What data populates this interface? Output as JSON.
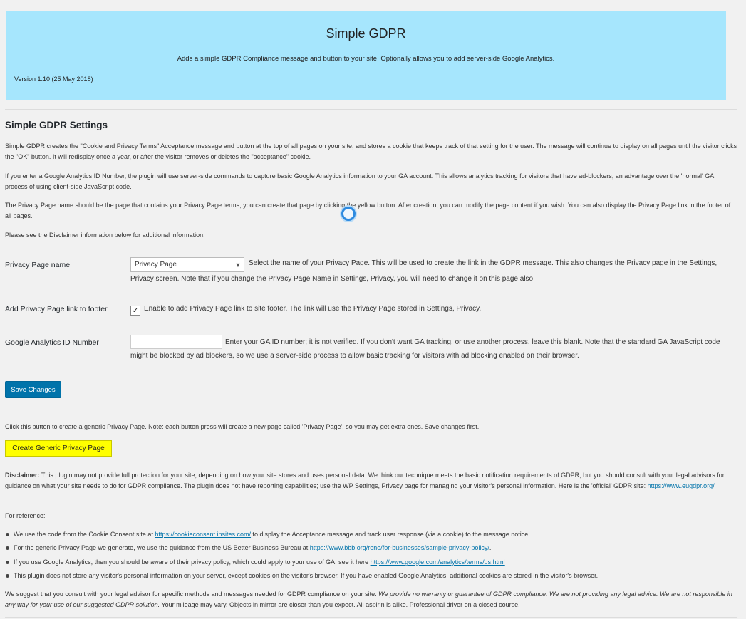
{
  "banner": {
    "title": "Simple GDPR",
    "description": "Adds a simple GDPR Compliance message and button to your site. Optionally allows you to add server-side Google Analytics.",
    "version": "Version 1.10 (25 May 2018)"
  },
  "settings": {
    "heading": "Simple GDPR Settings",
    "intro": [
      "Simple GDPR creates the \"Cookie and Privacy Terms\" Acceptance message and button at the top of all pages on your site, and stores a cookie that keeps track of that setting for the user. The message will continue to display on all pages until the visitor clicks the \"OK\" button. It will redisplay once a year, or after the visitor removes or deletes the \"acceptance\" cookie.",
      "If you enter a Google Analytics ID Number, the plugin will use server-side commands to capture basic Google Analytics information to your GA account. This allows analytics tracking for visitors that have ad-blockers, an advantage over the 'normal' GA process of using client-side JavaScript code.",
      "The Privacy Page name should be the page that contains your Privacy Page terms; you can create that page by clicking the yellow button. After creation, you can modify the page content if you wish. You can also display the Privacy Page link in the footer of all pages.",
      "Please see the Disclaimer information below for additional information."
    ],
    "privacy_page": {
      "label": "Privacy Page name",
      "selected": "Privacy Page",
      "description": "Select the name of your Privacy Page. This will be used to create the link in the GDPR message.  This also changes the Privacy page in the Settings, Privacy screen. Note that if you change the Privacy Page Name in Settings, Privacy, you will need to change it on this page also."
    },
    "footer_link": {
      "label": "Add Privacy Page link to footer",
      "checked": true,
      "check_glyph": "✓",
      "description": "Enable to add Privacy Page link to site footer. The link will use the Privacy Page stored in Settings, Privacy."
    },
    "ga": {
      "label": "Google Analytics ID Number",
      "value": "",
      "description": "Enter your GA ID number; it is not verified. If you don't want GA tracking, or use another process, leave this blank. Note that the standard GA JavaScript code might be blocked by ad blockers, so we use a server-side process to allow basic tracking for visitors with ad blocking enabled on their browser."
    },
    "save_label": "Save Changes"
  },
  "create": {
    "note": "Click this button to create a generic Privacy Page. Note: each button press will create a new page called 'Privacy Page', so you may get extra ones. Save changes first.",
    "button_label": "Create Generic Privacy Page"
  },
  "disclaimer": {
    "label": "Disclaimer:",
    "text": " This plugin may not provide full protection for your site, depending on how your site stores and uses personal data. We think our technique meets the basic notification requirements of GDPR, but you should consult with your legal advisors for guidance on what your site needs to do for GDPR compliance. The plugin does not have reporting capabilities; use the WP Settings, Privacy page for managing your visitor's personal information. Here is the 'official' GDPR site: ",
    "link": "https://www.eugdpr.org/",
    "after_link": " .",
    "reference_label": "For reference:",
    "refs": [
      {
        "before": "We use the code from the Cookie Consent site at ",
        "link": "https://cookieconsent.insites.com/",
        "after": " to display the Acceptance message and track user response (via a cookie) to the message notice."
      },
      {
        "before": "For the generic Privacy Page we generate, we use the guidance from the US Better Business Bureau at ",
        "link": "https://www.bbb.org/reno/for-businesses/sample-privacy-policy/",
        "after": "."
      },
      {
        "before": "If you use Google Analytics, then you should be aware of their privacy policy, which could apply to your use of GA; see it here ",
        "link": "https://www.google.com/analytics/terms/us.html",
        "after": ""
      },
      {
        "before": "This plugin does not store any visitor's personal information on your server, except cookies on the visitor's browser. If you have enabled Google Analytics, additional cookies are stored in the visitor's browser.",
        "link": "",
        "after": ""
      }
    ],
    "closing_plain": "We suggest that you consult with your legal advisor for specific methods and messages needed for GDPR compliance on your site. ",
    "closing_italic": "We provide no warranty or guarantee of GDPR compliance. We are not providing any legal advice. We are not responsible in any way for your use of our suggested GDPR solution.",
    "closing_tail": " Your mileage may vary. Objects in mirror are closer than you expect. All aspirin is alike. Professional driver on a closed course."
  },
  "colors": {
    "banner_bg": "#a6e6fd",
    "primary_button": "#0073aa",
    "create_button": "#ffff00",
    "link": "#0073aa"
  }
}
